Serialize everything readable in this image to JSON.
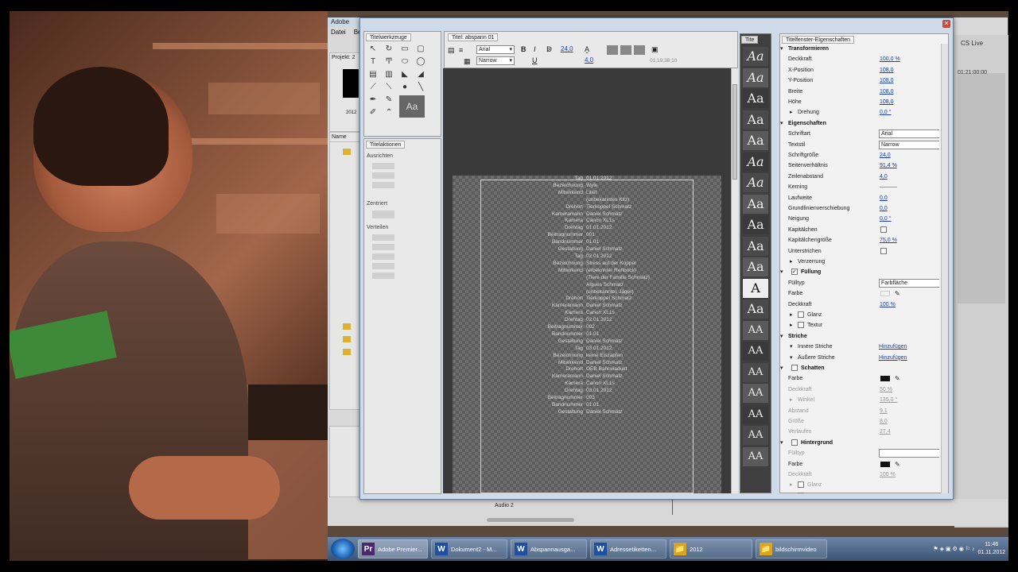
{
  "bg_window": {
    "title": "Adobe",
    "menu": [
      "Datei",
      "Be"
    ],
    "project_label": "Projekt: 2",
    "date_folder": "2012",
    "name_col": "Name",
    "cs_live": "CS Live",
    "timecode": "01:21:00:00"
  },
  "tools_panel": {
    "tab": "Titelwerkzeuge"
  },
  "actions_panel": {
    "tab": "Titelaktionen",
    "ausrichten": "Ausrichten",
    "zentriert": "Zentriert",
    "verteilen": "Verteilen"
  },
  "title_panel": {
    "tab": "Titel: abspann 01",
    "font": "Arial",
    "style": "Narrow",
    "size": "24,0",
    "kerning": "4,0",
    "timecode": "01;19;38;10"
  },
  "styles_panel": {
    "tab": "Tite"
  },
  "props_panel": {
    "tab": "Titelfenster-Eigenschaften",
    "rows": [
      {
        "type": "h",
        "label": "Transformieren",
        "icon": "triangle"
      },
      {
        "type": "v",
        "label": "Deckkraft",
        "value": "100,0 %"
      },
      {
        "type": "v",
        "label": "X-Position",
        "value": "108,0"
      },
      {
        "type": "v",
        "label": "Y-Position",
        "value": "108,0"
      },
      {
        "type": "v",
        "label": "Breite",
        "value": "108,0"
      },
      {
        "type": "v",
        "label": "Höhe",
        "value": "108,0"
      },
      {
        "type": "sub",
        "label": "Drehung",
        "value": "0,0 °"
      },
      {
        "type": "h",
        "label": "Eigenschaften",
        "icon": "triangle"
      },
      {
        "type": "sel",
        "label": "Schriftart",
        "value": "Arial"
      },
      {
        "type": "sel",
        "label": "Textstil",
        "value": "Narrow"
      },
      {
        "type": "v",
        "label": "Schriftgröße",
        "value": "24,0"
      },
      {
        "type": "v",
        "label": "Seitenverhältnis",
        "value": "91,4 %"
      },
      {
        "type": "v",
        "label": "Zeilenabstand",
        "value": "4,0"
      },
      {
        "type": "v",
        "label": "Kerning",
        "value": ""
      },
      {
        "type": "v",
        "label": "Laufweite",
        "value": "0,0"
      },
      {
        "type": "v",
        "label": "Grundlinienverschiebung",
        "value": "0,0"
      },
      {
        "type": "v",
        "label": "Neigung",
        "value": "0,0 °"
      },
      {
        "type": "cb",
        "label": "Kapitälchen"
      },
      {
        "type": "v",
        "label": "Kapitälchengröße",
        "value": "75,0 %"
      },
      {
        "type": "cb",
        "label": "Unterstrichen"
      },
      {
        "type": "sub",
        "label": "Verzerrung",
        "value": ""
      },
      {
        "type": "hcb",
        "label": "Füllung",
        "checked": true
      },
      {
        "type": "sel",
        "label": "Fülltyp",
        "value": "Farbfläche"
      },
      {
        "type": "swl",
        "label": "Farbe",
        "color": "#f2f2f2"
      },
      {
        "type": "v",
        "label": "Deckkraft",
        "value": "100 %"
      },
      {
        "type": "subcb",
        "label": "Glanz"
      },
      {
        "type": "subcb",
        "label": "Textur"
      },
      {
        "type": "h",
        "label": "Striche",
        "icon": "triangle"
      },
      {
        "type": "link",
        "label": "Innere Striche",
        "value": "Hinzufügen"
      },
      {
        "type": "link",
        "label": "Äußere Striche",
        "value": "Hinzufügen"
      },
      {
        "type": "hcb",
        "label": "Schatten",
        "checked": false
      },
      {
        "type": "swd",
        "label": "Farbe",
        "color": "#111111"
      },
      {
        "type": "dim",
        "label": "Deckkraft",
        "value": "50 %"
      },
      {
        "type": "dimsub",
        "label": "Winkel",
        "value": "135,0 °"
      },
      {
        "type": "dim",
        "label": "Abstand",
        "value": "9,1"
      },
      {
        "type": "dim",
        "label": "Größe",
        "value": "8,0"
      },
      {
        "type": "dim",
        "label": "Verlaufen",
        "value": "27,4"
      },
      {
        "type": "hcb",
        "label": "Hintergrund",
        "checked": false
      },
      {
        "type": "dimsel",
        "label": "Fülltyp",
        "value": ""
      },
      {
        "type": "swd",
        "label": "Farbe",
        "color": "#111111"
      },
      {
        "type": "dim",
        "label": "Deckkraft",
        "value": "100 %"
      },
      {
        "type": "dimsubcb",
        "label": "Glanz"
      },
      {
        "type": "dimsubcb",
        "label": "Textur"
      }
    ]
  },
  "credits": [
    {
      "k": "Tag",
      "v": "01.01.2012"
    },
    {
      "k": "Bezeichnung",
      "v": "Wyle"
    },
    {
      "k": "Mitwirkend",
      "v": "Lilief"
    },
    {
      "k": "",
      "v": "(unbekanntes Kitz)"
    },
    {
      "k": "Drehort",
      "v": "Tierkoppel Schmatz"
    },
    {
      "k": "Kameramann",
      "v": "Daniel Schmatz"
    },
    {
      "k": "Kamera",
      "v": "Canon XL1s"
    },
    {
      "k": "Drehtag",
      "v": "01.01.2012"
    },
    {
      "k": "Beitragnummer",
      "v": "001"
    },
    {
      "k": "Bandnummer",
      "v": "01.01"
    },
    {
      "k": "Gestaltung",
      "v": "Daniel Schmatz"
    },
    {
      "k": "",
      "v": ""
    },
    {
      "k": "",
      "v": ""
    },
    {
      "k": "",
      "v": ""
    },
    {
      "k": "Tag",
      "v": "02.01.2012"
    },
    {
      "k": "Bezeichnung",
      "v": "Stress auf der Koppel"
    },
    {
      "k": "Mitwirkend",
      "v": "(erbeknnter Rehbock)"
    },
    {
      "k": "",
      "v": "(Tiere der Familie Schmatz)"
    },
    {
      "k": "",
      "v": "Algues Schmatz"
    },
    {
      "k": "",
      "v": "(unbekanntes Jäger)"
    },
    {
      "k": "Drehort",
      "v": "Tierkoppel Schmatz"
    },
    {
      "k": "Kameramann",
      "v": "Daniel Schmatz"
    },
    {
      "k": "Kamera",
      "v": "Canon XL1s"
    },
    {
      "k": "Drehtag",
      "v": "02.01.2012"
    },
    {
      "k": "Beitragnummer",
      "v": "002"
    },
    {
      "k": "Bandnummer",
      "v": "01.01"
    },
    {
      "k": "Gestaltung",
      "v": "Daniel Schmatz"
    },
    {
      "k": "",
      "v": ""
    },
    {
      "k": "",
      "v": ""
    },
    {
      "k": "",
      "v": ""
    },
    {
      "k": "Tag",
      "v": "03.01.2012"
    },
    {
      "k": "Bezeichnung",
      "v": "keine Eiszapfen"
    },
    {
      "k": "Mitwirkend",
      "v": "Daniel Schmatz"
    },
    {
      "k": "Drehort",
      "v": "OEB Bahnviadukt"
    },
    {
      "k": "Kameramann",
      "v": "Daniel Schmatz"
    },
    {
      "k": "Kamera",
      "v": "Canon XL1s"
    },
    {
      "k": "Drehtag",
      "v": "03.01.2012"
    },
    {
      "k": "Beitragnummer",
      "v": "003"
    },
    {
      "k": "Bandnummer",
      "v": "01.01"
    },
    {
      "k": "Gestaltung",
      "v": "Daniel Schmatz"
    }
  ],
  "bottom": {
    "audio_track": "Audio 2"
  },
  "taskbar": {
    "items": [
      {
        "icon": "Pr",
        "label": "Adobe Premier...",
        "color": "#4a2a6a"
      },
      {
        "icon": "W",
        "label": "Dokument2 - M...",
        "color": "#1f4fa0"
      },
      {
        "icon": "W",
        "label": "Abspannausga...",
        "color": "#1f4fa0"
      },
      {
        "icon": "W",
        "label": "Adressetiketten...",
        "color": "#1f4fa0"
      },
      {
        "icon": "📁",
        "label": "2012",
        "color": "#d9a520"
      },
      {
        "icon": "📁",
        "label": "bildschirmvideo",
        "color": "#d9a520"
      }
    ],
    "time": "11:46",
    "date": "01.11.2012"
  }
}
